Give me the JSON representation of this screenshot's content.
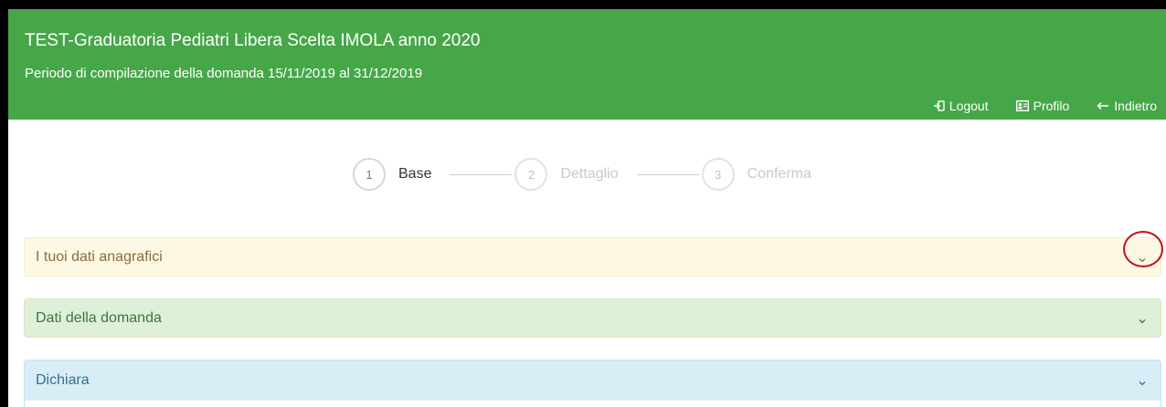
{
  "header": {
    "title": "TEST-Graduatoria Pediatri Libera Scelta IMOLA anno 2020",
    "subtitle": "Periodo di compilazione della domanda 15/11/2019 al 31/12/2019",
    "nav": [
      {
        "label": "Logout",
        "icon": "logout-icon"
      },
      {
        "label": "Profilo",
        "icon": "id-card-icon"
      },
      {
        "label": "Indietro",
        "icon": "arrow-left-icon"
      }
    ],
    "color": "#46a748"
  },
  "wizard": {
    "steps": [
      {
        "number": "1",
        "label": "Base",
        "active": true
      },
      {
        "number": "2",
        "label": "Dettaglio",
        "active": false
      },
      {
        "number": "3",
        "label": "Conferma",
        "active": false
      }
    ]
  },
  "panels": [
    {
      "title": "I tuoi dati anagrafici",
      "style": "warning",
      "icon": "chevron-down-icon",
      "highlighted": true
    },
    {
      "title": "Dati della domanda",
      "style": "success",
      "icon": "chevron-down-icon"
    },
    {
      "title": "Dichiara",
      "style": "info",
      "icon": "chevron-down-icon"
    }
  ],
  "colors": {
    "highlight_ring": "#c0121a",
    "panel_warning": "#fcf8e3",
    "panel_success": "#dff0d8",
    "panel_info": "#d9edf7"
  }
}
